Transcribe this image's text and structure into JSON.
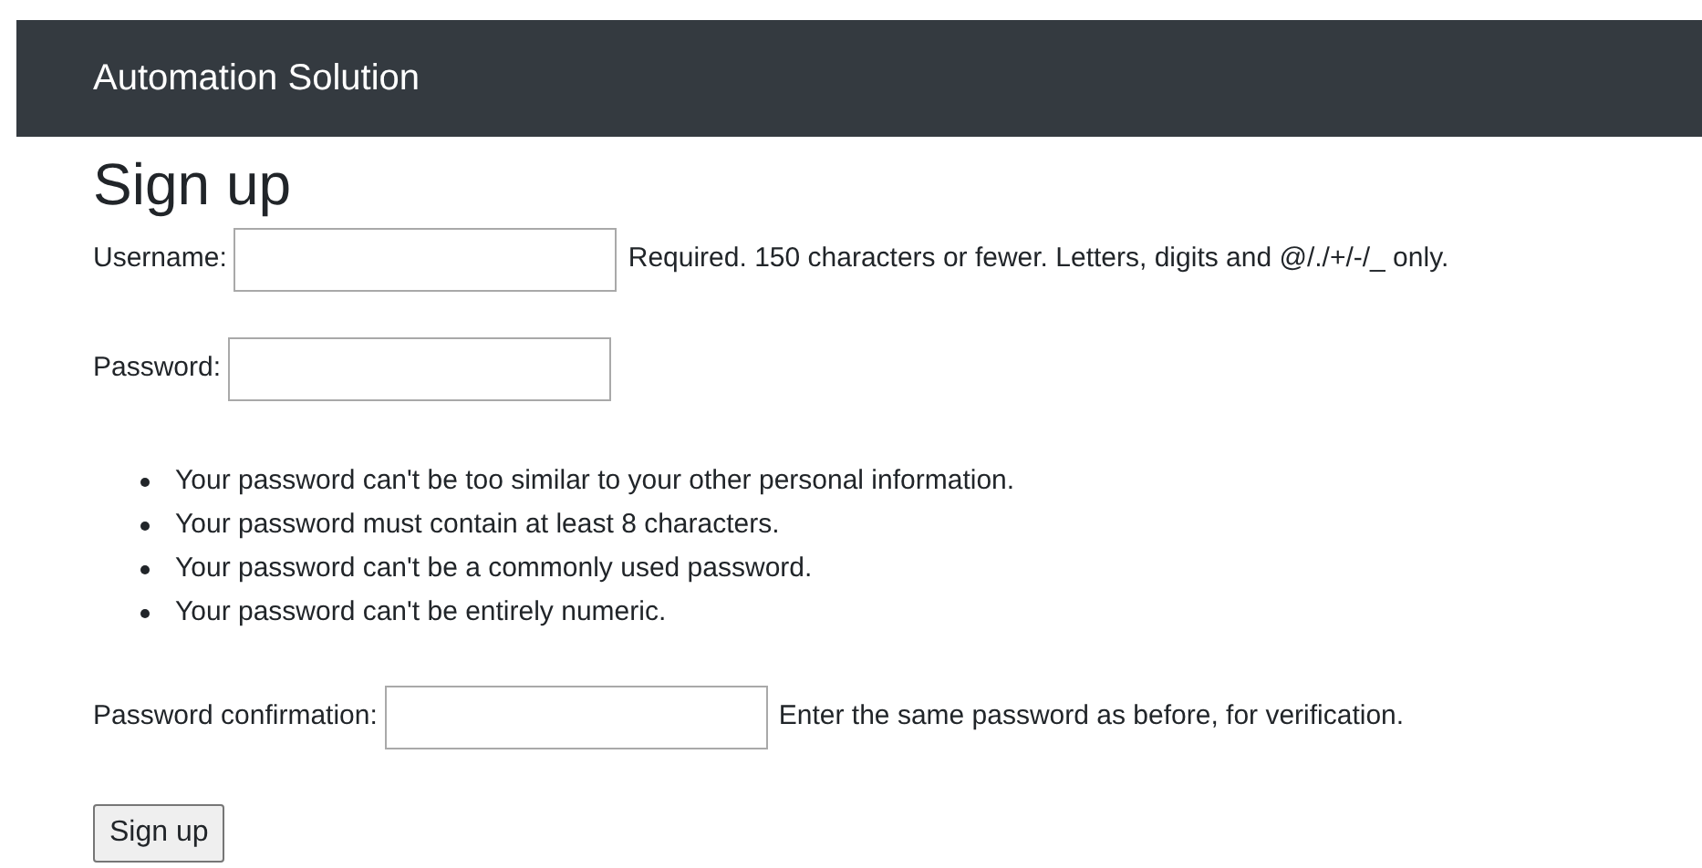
{
  "navbar": {
    "brand": "Automation Solution"
  },
  "heading": "Sign up",
  "fields": [
    {
      "label": "Username:",
      "help": "Required. 150 characters or fewer. Letters, digits and @/./+/-/_ only."
    },
    {
      "label": "Password:",
      "help_list": [
        "Your password can't be too similar to your other personal information.",
        "Your password must contain at least 8 characters.",
        "Your password can't be a commonly used password.",
        "Your password can't be entirely numeric."
      ]
    },
    {
      "label": "Password confirmation:",
      "help": "Enter the same password as before, for verification."
    }
  ],
  "submit": "Sign up"
}
